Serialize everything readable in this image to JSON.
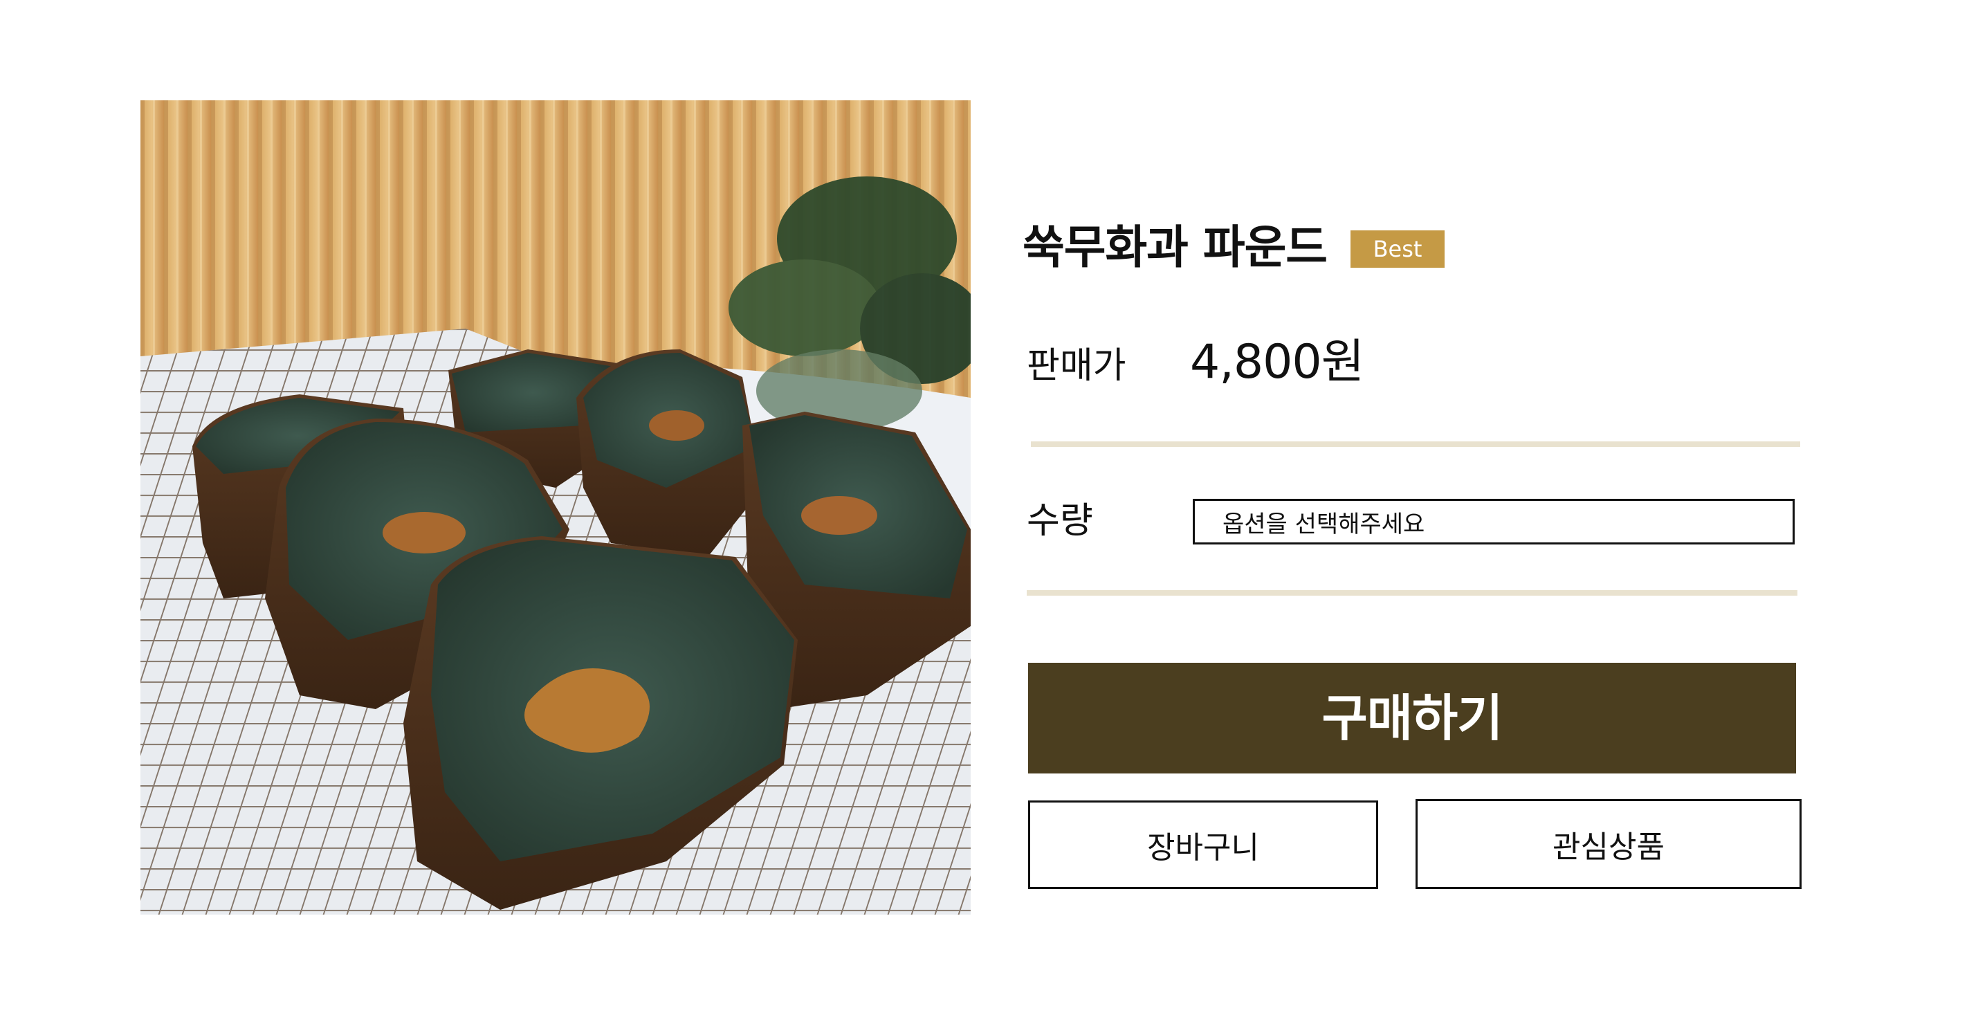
{
  "product": {
    "image_alt": "쑥무화과 파운드",
    "title": "쑥무화과 파운드",
    "badge": "Best"
  },
  "price": {
    "label": "판매가",
    "value": "4,800원"
  },
  "quantity": {
    "label": "수량",
    "select_value": "옵션을 선택해주세요"
  },
  "actions": {
    "buy_label": "구매하기",
    "cart_label": "장바구니",
    "wishlist_label": "관심상품"
  },
  "colors": {
    "badge": "#c59a45",
    "buy_button": "#4b3e1f",
    "divider": "#e9e2cf"
  }
}
